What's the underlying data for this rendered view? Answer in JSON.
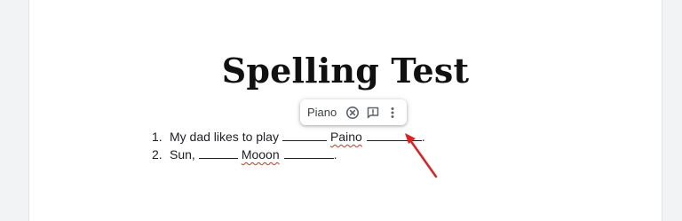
{
  "document": {
    "title": "Spelling Test",
    "items": [
      {
        "number": "1.",
        "before": "My dad likes to play",
        "word": "Paino",
        "after": "."
      },
      {
        "number": "2.",
        "before": "Sun,",
        "word": "Mooon",
        "after": "."
      }
    ]
  },
  "spell_suggestion": {
    "suggested_word": "Piano",
    "icons": [
      "close-circle-icon",
      "feedback-icon",
      "more-vert-icon"
    ]
  },
  "colors": {
    "spell_error": "#d93025",
    "arrow": "#e02020",
    "text": "#202124"
  }
}
